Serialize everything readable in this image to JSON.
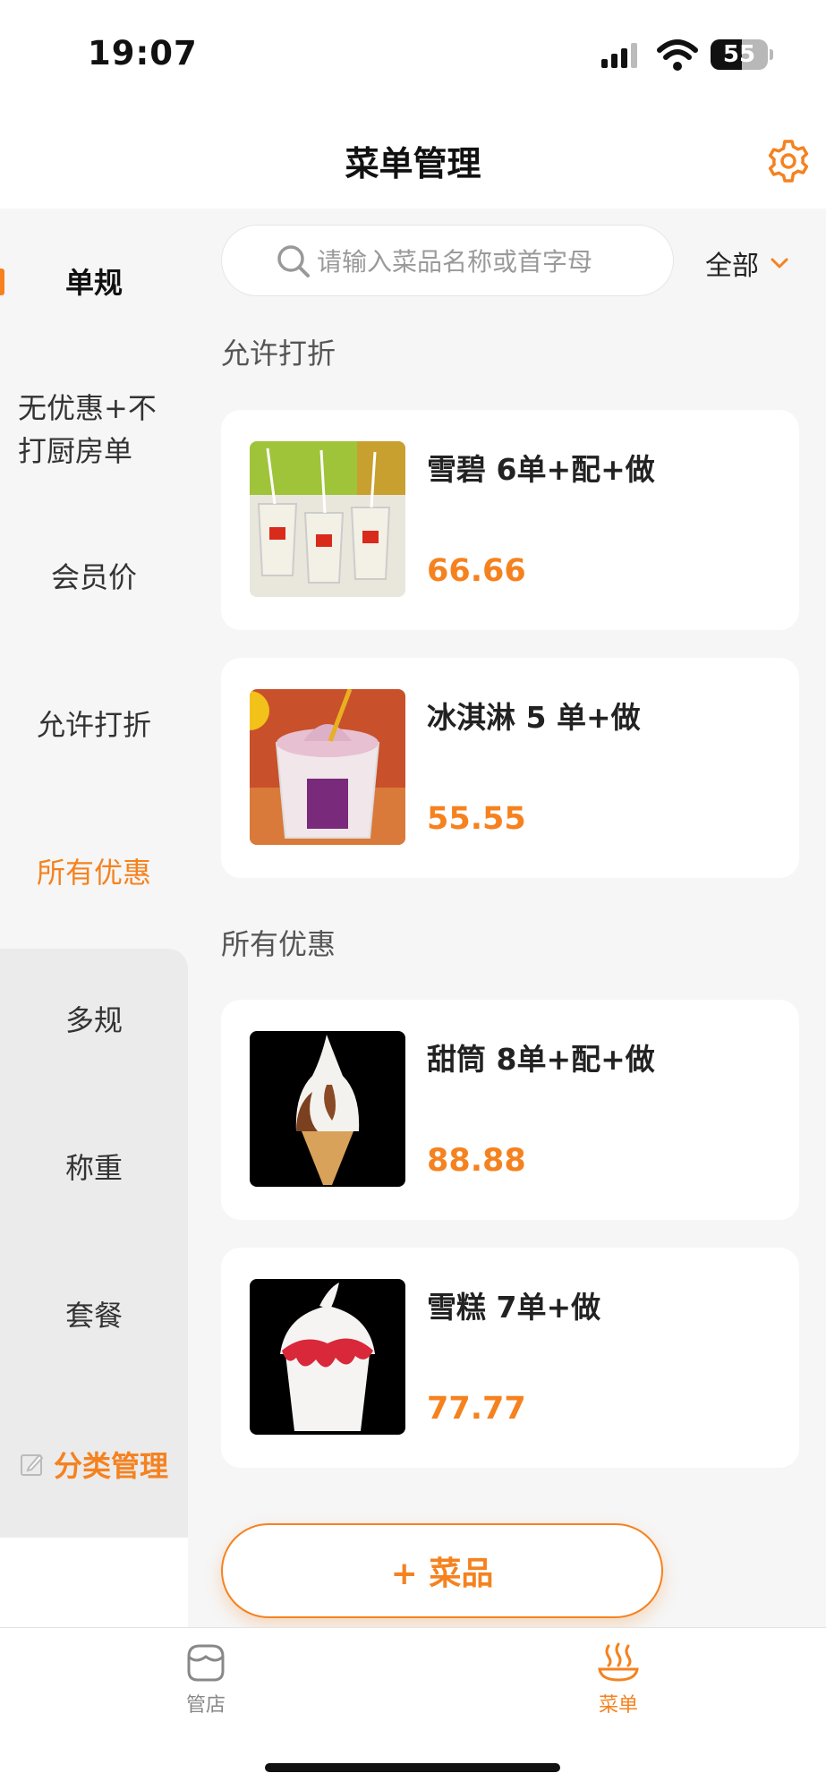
{
  "status_bar": {
    "time": "19:07",
    "battery": "55"
  },
  "header": {
    "title": "菜单管理"
  },
  "sidebar": {
    "items": [
      {
        "label": "单规"
      },
      {
        "label": "无优惠+不打厨房单"
      },
      {
        "label": "会员价"
      },
      {
        "label": "允许打折"
      },
      {
        "label": "所有优惠"
      },
      {
        "label": "多规"
      },
      {
        "label": "称重"
      },
      {
        "label": "套餐"
      }
    ],
    "manage_label": "分类管理"
  },
  "search": {
    "placeholder": "请输入菜品名称或首字母"
  },
  "filter": {
    "label": "全部"
  },
  "sections": [
    {
      "title": "允许打折",
      "items": [
        {
          "name": "雪碧 6单+配+做",
          "price": "66.66"
        },
        {
          "name": "冰淇淋 5 单+做",
          "price": "55.55"
        }
      ]
    },
    {
      "title": "所有优惠",
      "items": [
        {
          "name": "甜筒 8单+配+做",
          "price": "88.88"
        },
        {
          "name": "雪糕 7单+做",
          "price": "77.77"
        }
      ]
    }
  ],
  "add_button": {
    "label": "+ 菜品"
  },
  "tabbar": {
    "tabs": [
      {
        "label": "管店",
        "icon": "store-icon"
      },
      {
        "label": "菜单",
        "icon": "menu-bowl-icon"
      }
    ]
  },
  "colors": {
    "accent": "#f5821f",
    "sidebar_bg": "#f6f6f6",
    "sidebar_panel": "#ebebeb"
  }
}
